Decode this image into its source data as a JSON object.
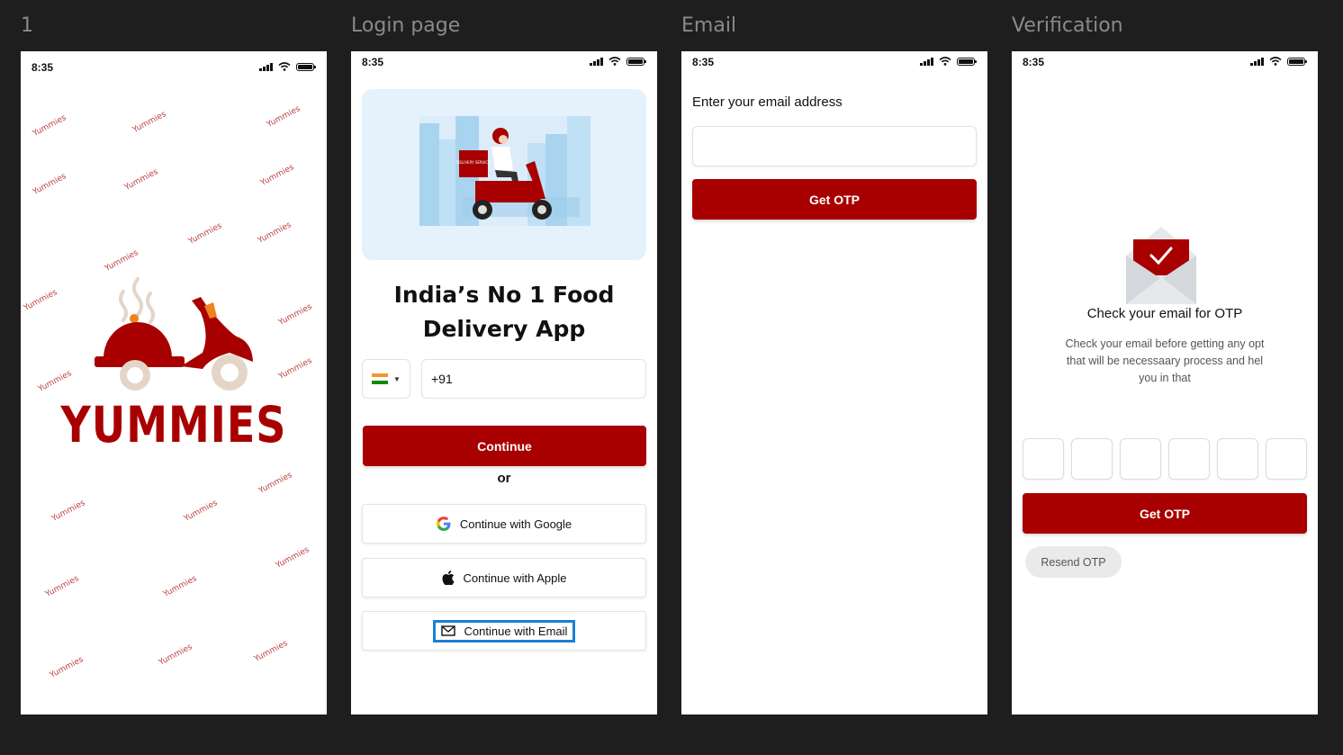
{
  "frame_titles": [
    "1",
    "Login page",
    "Email",
    "Verification"
  ],
  "status_time": "8:35",
  "splash": {
    "pattern_word": "Yummies",
    "brand_name": "YUMMIES",
    "brand_color": "#a80000"
  },
  "login": {
    "hero_box_label": "DELIVERY SERVICE",
    "headline_line1": "India’s No 1 Food",
    "headline_line2": "Delivery App",
    "phone_prefix": "+91",
    "continue_label": "Continue",
    "or_label": "or",
    "google_label": "Continue with Google",
    "apple_label": "Continue with Apple",
    "email_label": "Continue with Email"
  },
  "email": {
    "prompt": "Enter your email address",
    "email_value": "",
    "get_otp_label": "Get OTP"
  },
  "verification": {
    "title": "Check your email for OTP",
    "description": "Check your email before getting any opt that will be necessaary process and hel you in that",
    "otp_digits": [
      "",
      "",
      "",
      "",
      "",
      ""
    ],
    "get_otp_label": "Get OTP",
    "resend_label": "Resend OTP"
  },
  "colors": {
    "primary": "#a80000",
    "focus": "#1b7fd6",
    "hero_bg": "#e5f1fb"
  }
}
